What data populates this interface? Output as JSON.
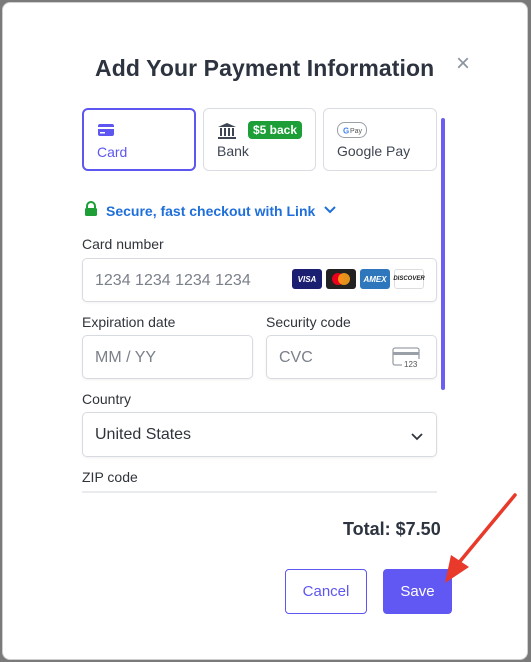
{
  "dialog": {
    "title": "Add Your Payment Information",
    "close_icon": "close-icon"
  },
  "tabs": [
    {
      "label": "Card",
      "icon": "card-icon",
      "active": true
    },
    {
      "label": "Bank",
      "icon": "bank-icon",
      "badge": "$5 back"
    },
    {
      "label": "Google Pay",
      "icon": "google-pay-icon"
    }
  ],
  "link": {
    "text": "Secure, fast checkout with Link",
    "icon": "lock-icon",
    "chevron": "chevron-down-icon"
  },
  "fields": {
    "card_number": {
      "label": "Card number",
      "placeholder": "1234 1234 1234 1234"
    },
    "expiration": {
      "label": "Expiration date",
      "placeholder": "MM / YY"
    },
    "security": {
      "label": "Security code",
      "placeholder": "CVC",
      "icon_text": "123"
    },
    "country": {
      "label": "Country",
      "value": "United States"
    },
    "zip": {
      "label": "ZIP code"
    }
  },
  "card_brands": [
    "VISA",
    "mastercard",
    "AMEX",
    "DISCOVER"
  ],
  "total": "Total: $7.50",
  "buttons": {
    "cancel": "Cancel",
    "save": "Save"
  },
  "colors": {
    "accent": "#5e56f0",
    "badge": "#1d9e36",
    "link": "#1f6fdb",
    "arrow": "#e8392b"
  }
}
